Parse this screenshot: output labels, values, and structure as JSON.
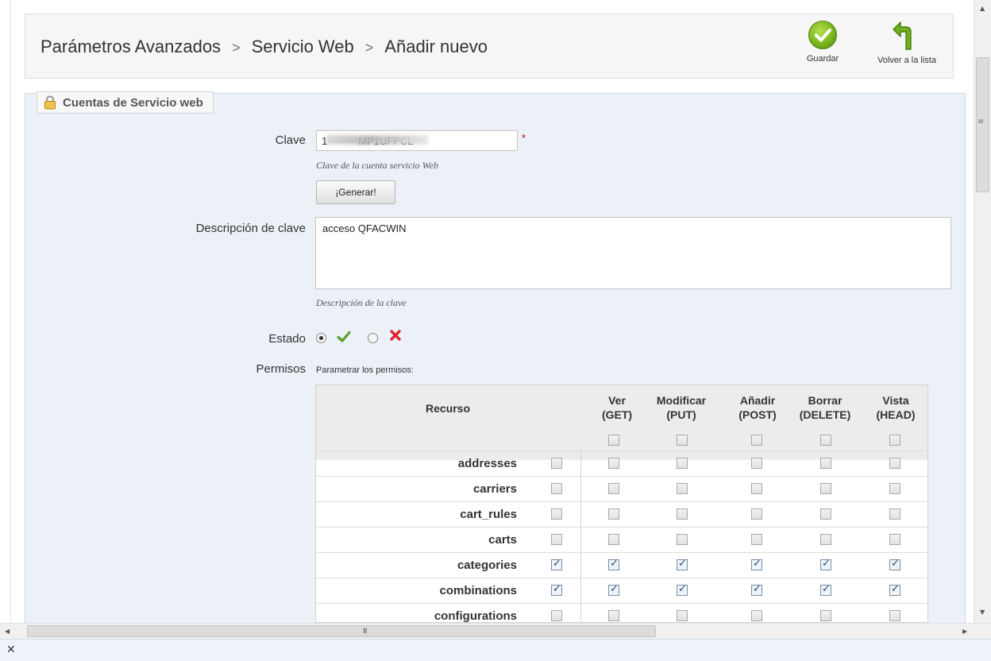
{
  "breadcrumb": {
    "items": [
      "Parámetros Avanzados",
      "Servicio Web",
      "Añadir nuevo"
    ],
    "separator": ">"
  },
  "toolbar": {
    "save_label": "Guardar",
    "back_label": "Volver a la lista"
  },
  "fieldset": {
    "legend": "Cuentas de Servicio web"
  },
  "form": {
    "key_label": "Clave",
    "key_value": "1·········MP1UFPCL",
    "key_required_mark": "*",
    "key_hint": "Clave de la cuenta servicio Web",
    "generate_label": "¡Generar!",
    "desc_label": "Descripción de clave",
    "desc_value": "acceso QFACWIN",
    "desc_hint": "Descripción de la clave",
    "status_label": "Estado",
    "status_value": "enabled",
    "permissions_label": "Permisos",
    "permissions_hint": "Parametrar los permisos:"
  },
  "permissions": {
    "resource_header": "Recurso",
    "columns": [
      {
        "line1": "Ver",
        "line2": "(GET)"
      },
      {
        "line1": "Modificar",
        "line2": "(PUT)"
      },
      {
        "line1": "Añadir",
        "line2": "(POST)"
      },
      {
        "line1": "Borrar",
        "line2": "(DELETE)"
      },
      {
        "line1": "Vista",
        "line2": "(HEAD)"
      }
    ],
    "rows": [
      {
        "name": "addresses",
        "checked": false
      },
      {
        "name": "carriers",
        "checked": false
      },
      {
        "name": "cart_rules",
        "checked": false
      },
      {
        "name": "carts",
        "checked": false
      },
      {
        "name": "categories",
        "checked": true
      },
      {
        "name": "combinations",
        "checked": true
      },
      {
        "name": "configurations",
        "checked": false
      }
    ]
  },
  "colors": {
    "fieldset_bg": "#ebf1f7",
    "save_green": "#79b51a",
    "back_green": "#6fae1c",
    "enable_check": "#5aa02c",
    "disable_x": "#d9262b"
  }
}
